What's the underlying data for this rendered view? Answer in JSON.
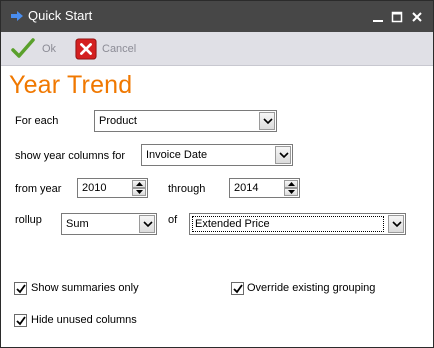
{
  "window": {
    "title": "Quick Start",
    "controls": [
      "minimize-icon",
      "maximize-icon",
      "close-icon"
    ]
  },
  "toolbar": {
    "ok_label": "Ok",
    "cancel_label": "Cancel"
  },
  "heading": "Year Trend",
  "form": {
    "for_each_label": "For each",
    "for_each_value": "Product",
    "year_columns_label": "show year columns for",
    "year_columns_value": "Invoice Date",
    "from_year_label": "from year",
    "from_year_value": "2010",
    "through_label": "through",
    "through_value": "2014",
    "rollup_label": "rollup",
    "rollup_value": "Sum",
    "of_label": "of",
    "of_value": "Extended Price"
  },
  "options": {
    "show_summaries_label": "Show summaries only",
    "show_summaries_checked": true,
    "override_grouping_label": "Override existing grouping",
    "override_grouping_checked": true,
    "hide_unused_label": "Hide unused columns",
    "hide_unused_checked": true
  },
  "colors": {
    "title_bar": "#474747",
    "toolbar": "#e0e0e6",
    "heading": "#f07800",
    "ok_check": "#5aa02c",
    "cancel_x": "#d42020"
  }
}
